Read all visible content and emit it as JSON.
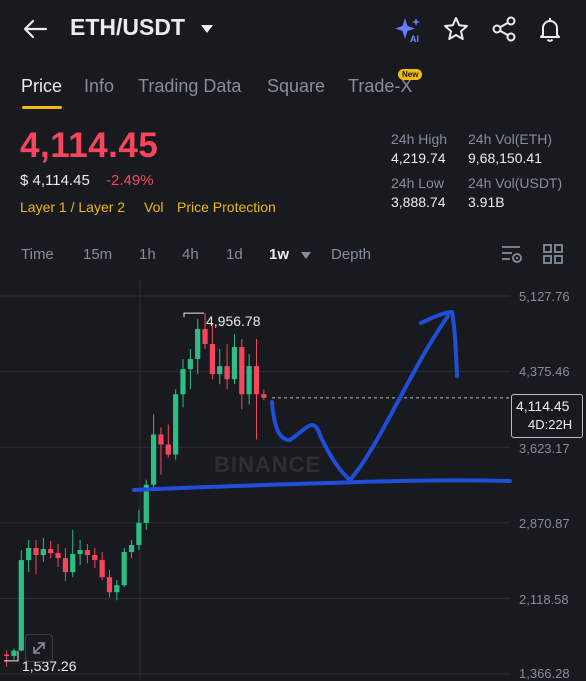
{
  "header": {
    "pair": "ETH/USDT",
    "icons": [
      "back-arrow-icon",
      "caret-down-icon",
      "ai-sparkle-icon",
      "star-icon",
      "share-icon",
      "bell-icon"
    ],
    "ai_badge": "AI"
  },
  "tabs": [
    {
      "label": "Price"
    },
    {
      "label": "Info"
    },
    {
      "label": "Trading Data"
    },
    {
      "label": "Square"
    },
    {
      "label": "Trade-X",
      "badge": "New"
    }
  ],
  "price": {
    "last": "4,114.45",
    "usd": "$ 4,114.45",
    "change": "-2.49%",
    "tags": [
      "Layer 1 / Layer 2",
      "Vol",
      "Price Protection"
    ]
  },
  "stats": {
    "high_label": "24h High",
    "high": "4,219.74",
    "vol_eth_label": "24h Vol(ETH)",
    "vol_eth": "9,68,150.41",
    "low_label": "24h Low",
    "low": "3,888.74",
    "vol_usdt_label": "24h Vol(USDT)",
    "vol_usdt": "3.91B"
  },
  "timeframes": [
    "Time",
    "15m",
    "1h",
    "4h",
    "1d",
    "1w",
    "Depth"
  ],
  "selected_timeframe": "1w",
  "chart_data": {
    "type": "candlestick",
    "y_axis_ticks": [
      "5,127.76",
      "4,375.46",
      "3,623.17",
      "2,870.87",
      "2,118.58",
      "1,366.28"
    ],
    "ylim": [
      1366.28,
      5127.76
    ],
    "current_price": "4,114.45",
    "countdown": "4D:22H",
    "period_high": "4,956.78",
    "period_low": "1,537.26",
    "watermark": "BINANCE",
    "colors": {
      "up": "#2ebd85",
      "down": "#f6465d",
      "annotation": "#1f4fd8"
    },
    "candles": [
      {
        "o": 1560,
        "h": 1600,
        "l": 1440,
        "c": 1545
      },
      {
        "o": 1545,
        "h": 1620,
        "l": 1510,
        "c": 1600
      },
      {
        "o": 1600,
        "h": 2600,
        "l": 1590,
        "c": 2500
      },
      {
        "o": 2500,
        "h": 2700,
        "l": 2380,
        "c": 2620
      },
      {
        "o": 2620,
        "h": 2700,
        "l": 2360,
        "c": 2550
      },
      {
        "o": 2550,
        "h": 2720,
        "l": 2480,
        "c": 2610
      },
      {
        "o": 2610,
        "h": 2690,
        "l": 2520,
        "c": 2570
      },
      {
        "o": 2570,
        "h": 2660,
        "l": 2430,
        "c": 2520
      },
      {
        "o": 2520,
        "h": 2620,
        "l": 2290,
        "c": 2380
      },
      {
        "o": 2380,
        "h": 2800,
        "l": 2330,
        "c": 2560
      },
      {
        "o": 2560,
        "h": 2700,
        "l": 2450,
        "c": 2600
      },
      {
        "o": 2600,
        "h": 2660,
        "l": 2470,
        "c": 2550
      },
      {
        "o": 2550,
        "h": 2620,
        "l": 2420,
        "c": 2500
      },
      {
        "o": 2500,
        "h": 2580,
        "l": 2300,
        "c": 2330
      },
      {
        "o": 2330,
        "h": 2400,
        "l": 2130,
        "c": 2180
      },
      {
        "o": 2180,
        "h": 2300,
        "l": 2100,
        "c": 2250
      },
      {
        "o": 2250,
        "h": 2620,
        "l": 2230,
        "c": 2580
      },
      {
        "o": 2580,
        "h": 2700,
        "l": 2520,
        "c": 2650
      },
      {
        "o": 2650,
        "h": 3000,
        "l": 2600,
        "c": 2870
      },
      {
        "o": 2870,
        "h": 3300,
        "l": 2800,
        "c": 3250
      },
      {
        "o": 3250,
        "h": 3950,
        "l": 3200,
        "c": 3750
      },
      {
        "o": 3750,
        "h": 3820,
        "l": 3350,
        "c": 3650
      },
      {
        "o": 3650,
        "h": 3850,
        "l": 3520,
        "c": 3550
      },
      {
        "o": 3550,
        "h": 4200,
        "l": 3500,
        "c": 4150
      },
      {
        "o": 4150,
        "h": 4500,
        "l": 4020,
        "c": 4400
      },
      {
        "o": 4400,
        "h": 4600,
        "l": 4200,
        "c": 4500
      },
      {
        "o": 4500,
        "h": 4900,
        "l": 4350,
        "c": 4800
      },
      {
        "o": 4800,
        "h": 4956.78,
        "l": 4600,
        "c": 4650
      },
      {
        "o": 4650,
        "h": 4850,
        "l": 4300,
        "c": 4350
      },
      {
        "o": 4350,
        "h": 4600,
        "l": 4250,
        "c": 4430
      },
      {
        "o": 4430,
        "h": 4650,
        "l": 4200,
        "c": 4300
      },
      {
        "o": 4300,
        "h": 4750,
        "l": 4250,
        "c": 4620
      },
      {
        "o": 4620,
        "h": 4700,
        "l": 4000,
        "c": 4150
      },
      {
        "o": 4150,
        "h": 4550,
        "l": 4050,
        "c": 4430
      },
      {
        "o": 4430,
        "h": 4700,
        "l": 3700,
        "c": 4150
      },
      {
        "o": 4150,
        "h": 4200,
        "l": 4090,
        "c": 4114.45
      }
    ]
  }
}
